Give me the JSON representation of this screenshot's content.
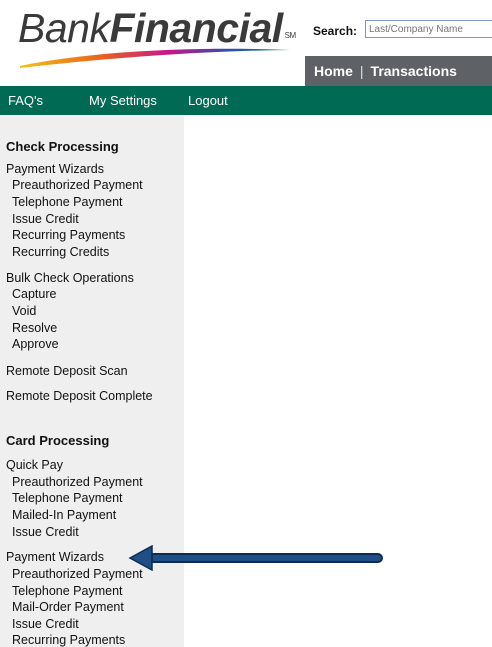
{
  "header": {
    "logo": {
      "word1": "Bank",
      "word2": "Financial",
      "mark": "SM"
    },
    "search": {
      "label": "Search:",
      "placeholder": "Last/Company Name"
    },
    "topnav": {
      "home": "Home",
      "separator": "|",
      "transactions": "Transactions"
    }
  },
  "greenbar": {
    "items": [
      "FAQ's",
      "My Settings",
      "Logout"
    ]
  },
  "colors": {
    "green_bar": "#006a55",
    "top_nav": "#5e6165",
    "sidebar_bg": "#efefef",
    "arrow": "#1f4f86"
  },
  "sidebar": {
    "check_processing": {
      "title": "Check Processing",
      "payment_wizards": {
        "label": "Payment Wizards",
        "items": [
          "Preauthorized Payment",
          "Telephone Payment",
          "Issue Credit",
          "Recurring Payments",
          "Recurring Credits"
        ]
      },
      "bulk_ops": {
        "label": "Bulk Check Operations",
        "items": [
          "Capture",
          "Void",
          "Resolve",
          "Approve"
        ]
      },
      "remote_deposit_scan": "Remote Deposit Scan",
      "remote_deposit_complete": "Remote Deposit Complete"
    },
    "card_processing": {
      "title": "Card Processing",
      "quick_pay": {
        "label": "Quick Pay",
        "items": [
          "Preauthorized Payment",
          "Telephone Payment",
          "Mailed-In Payment",
          "Issue Credit"
        ]
      },
      "payment_wizards": {
        "label": "Payment Wizards",
        "items": [
          "Preauthorized Payment",
          "Telephone Payment",
          "Mail-Order Payment",
          "Issue Credit",
          "Recurring Payments"
        ]
      }
    }
  }
}
